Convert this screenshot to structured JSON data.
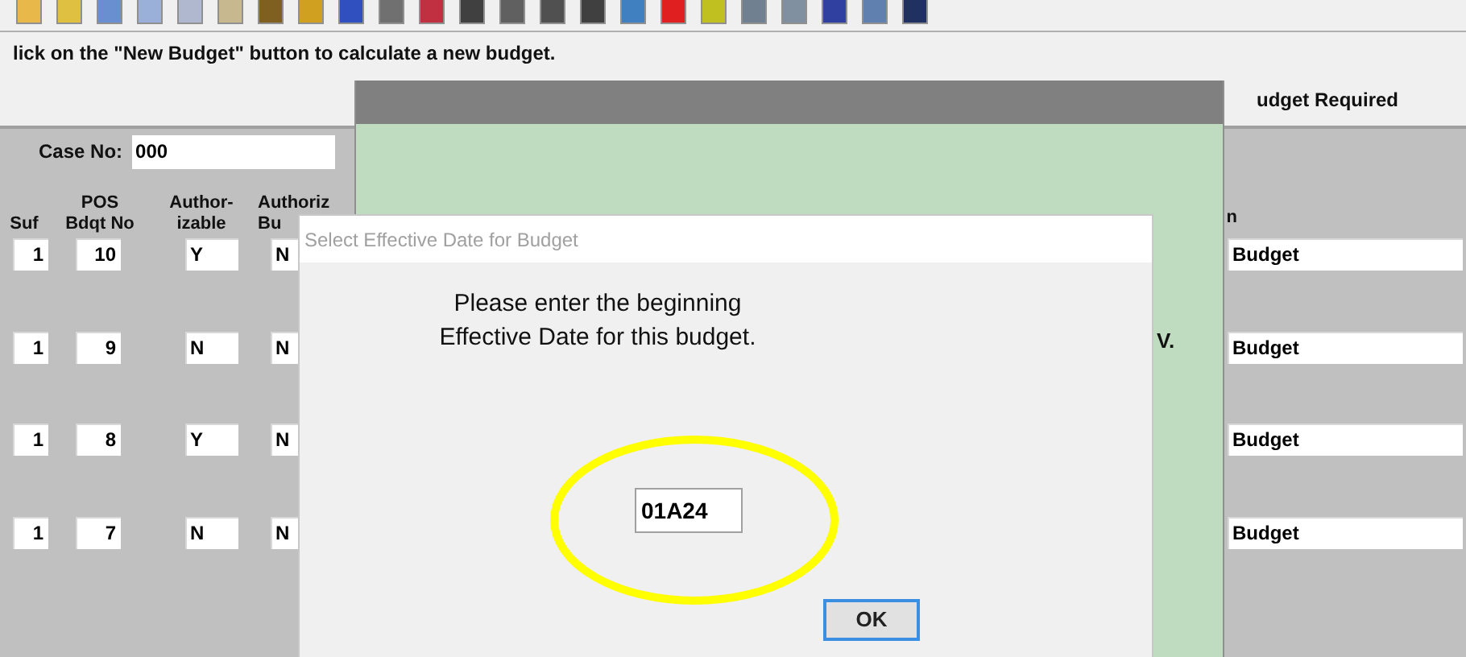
{
  "instruction": "lick on the \"New Budget\" button to calculate a new budget.",
  "header_right": "udget Required",
  "case_no": {
    "label": "Case No:",
    "value": "000"
  },
  "columns": [
    {
      "lines": [
        "Suf"
      ]
    },
    {
      "lines": [
        "POS",
        "Bdqt No"
      ]
    },
    {
      "lines": [
        "Author-",
        "izable"
      ]
    },
    {
      "lines": [
        "Authoriz",
        "Bu"
      ]
    }
  ],
  "right_column": {
    "header": "n"
  },
  "rows": [
    {
      "suf": "1",
      "pos_no": "10",
      "authorizable": "Y",
      "column_4": "N",
      "right": "Budget"
    },
    {
      "suf": "1",
      "pos_no": "9",
      "authorizable": "N",
      "column_4": "N",
      "right": "Budget"
    },
    {
      "suf": "1",
      "pos_no": "8",
      "authorizable": "Y",
      "column_4": "N",
      "right": "Budget"
    },
    {
      "suf": "1",
      "pos_no": "7",
      "authorizable": "N",
      "column_4": "N",
      "right": "Budget"
    }
  ],
  "panel": {
    "text": "V."
  },
  "dialog": {
    "title": "Select Effective Date for Budget",
    "message": [
      "Please enter the beginning",
      "Effective Date for this budget."
    ],
    "date_value": "01A24",
    "ok": "OK"
  }
}
